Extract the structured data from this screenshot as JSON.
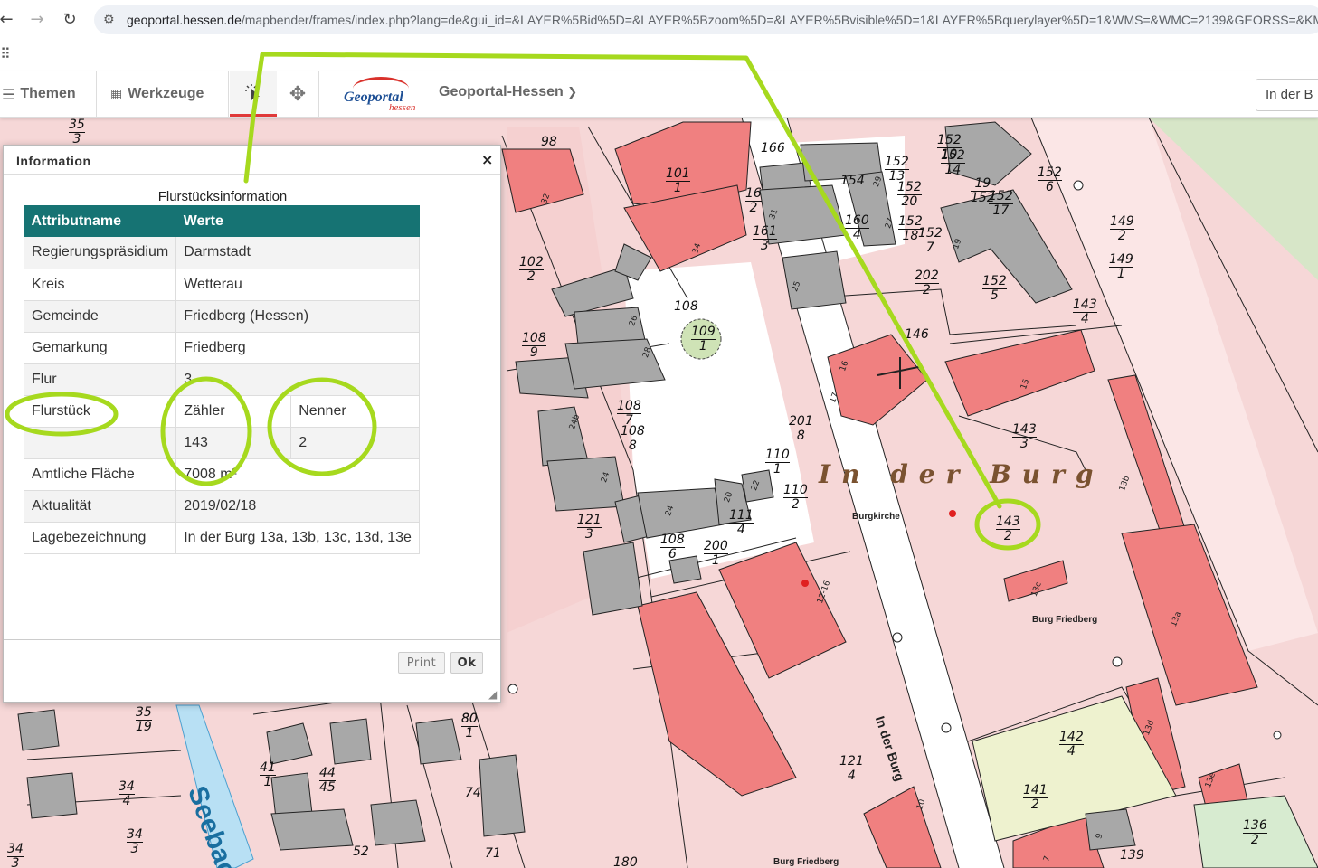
{
  "browser": {
    "url_host": "geoportal.hessen.de",
    "url_path": "/mapbender/frames/index.php?lang=de&gui_id=&LAYER%5Bid%5D=&LAYER%5Bzoom%5D=&LAYER%5Bvisible%5D=1&LAYER%5Bquerylayer%5D=1&WMS=&WMC=2139&GEORSS=&KML=&"
  },
  "toolbar": {
    "themen_label": "Themen",
    "werkzeuge_label": "Werkzeuge",
    "logo_main": "Geoportal",
    "logo_sub": "hessen",
    "portal_label": "Geoportal-Hessen",
    "search_value": "In der B"
  },
  "dialog": {
    "title": "Information",
    "close_label": "×",
    "caption": "Flurstücksinformation",
    "headers": [
      "Attributname",
      "Werte"
    ],
    "rows": [
      [
        "Regierungspräsidium",
        "Darmstadt",
        ""
      ],
      [
        "Kreis",
        "Wetterau",
        ""
      ],
      [
        "Gemeinde",
        "Friedberg (Hessen)",
        ""
      ],
      [
        "Gemarkung",
        "Friedberg",
        ""
      ],
      [
        "Flur",
        "3",
        ""
      ],
      [
        "Flurstück",
        "Zähler",
        "Nenner"
      ],
      [
        "",
        "143",
        "2"
      ],
      [
        "Amtliche Fläche",
        "7008 m²",
        ""
      ],
      [
        "Aktualität",
        "2019/02/18",
        ""
      ],
      [
        "Lagebezeichnung",
        "In der Burg 13a, 13b, 13c, 13d, 13e",
        ""
      ]
    ],
    "print_label": "Print",
    "ok_label": "Ok"
  },
  "map": {
    "street_label_big": "In der Burg",
    "street_label_vertical": "In der Burg",
    "stream_label": "Seebach",
    "church_label": "Burgkirche",
    "castle_label": "Burg Friedberg",
    "castle_label_bottom": "Burg Friedberg",
    "parcel_labels": [
      [
        "35",
        "3"
      ],
      [
        "98",
        ""
      ],
      [
        "101",
        "1"
      ],
      [
        "102",
        "2"
      ],
      [
        "108",
        "9"
      ],
      [
        "108",
        "7"
      ],
      [
        "108",
        "8"
      ],
      [
        "108",
        ""
      ],
      [
        "109",
        "1"
      ],
      [
        "110",
        "1"
      ],
      [
        "110",
        "2"
      ],
      [
        "111",
        "4"
      ],
      [
        "108",
        "6"
      ],
      [
        "200",
        "1"
      ],
      [
        "121",
        "3"
      ],
      [
        "201",
        "8"
      ],
      [
        "143",
        "3"
      ],
      [
        "143",
        "2"
      ],
      [
        "152",
        "5"
      ],
      [
        "152",
        "10"
      ],
      [
        "152",
        "14"
      ],
      [
        "152",
        "13"
      ],
      [
        "152",
        "20"
      ],
      [
        "152",
        "18"
      ],
      [
        "152",
        "7"
      ],
      [
        "152",
        "17"
      ],
      [
        "152",
        "6"
      ],
      [
        "149",
        "2"
      ],
      [
        "149",
        "1"
      ],
      [
        "143",
        "4"
      ],
      [
        "146",
        ""
      ],
      [
        "202",
        "2"
      ],
      [
        "160",
        "4"
      ],
      [
        "161",
        "3"
      ],
      [
        "166",
        ""
      ],
      [
        "154",
        ""
      ],
      [
        "16",
        "2"
      ],
      [
        "121",
        "4"
      ],
      [
        "142",
        "4"
      ],
      [
        "141",
        "2"
      ],
      [
        "136",
        "2"
      ],
      [
        "139",
        ""
      ],
      [
        "35",
        "19"
      ],
      [
        "34",
        "4"
      ],
      [
        "34",
        "3"
      ],
      [
        "41",
        "1"
      ],
      [
        "80",
        "1"
      ],
      [
        "74",
        ""
      ],
      [
        "71",
        ""
      ],
      [
        "44",
        "45"
      ],
      [
        "52",
        ""
      ],
      [
        "34",
        "3"
      ],
      [
        "180",
        ""
      ],
      [
        "80",
        "1"
      ],
      [
        "19",
        "152"
      ]
    ],
    "building_numbers": [
      "32",
      "34",
      "25",
      "26",
      "28",
      "24b",
      "24",
      "20",
      "22",
      "17",
      "15",
      "13b",
      "13c",
      "13a",
      "13d",
      "13e",
      "19",
      "16",
      "31",
      "27",
      "29",
      "10",
      "9",
      "7",
      "12-16",
      "24"
    ]
  },
  "annotation_color": "#a6d91e"
}
